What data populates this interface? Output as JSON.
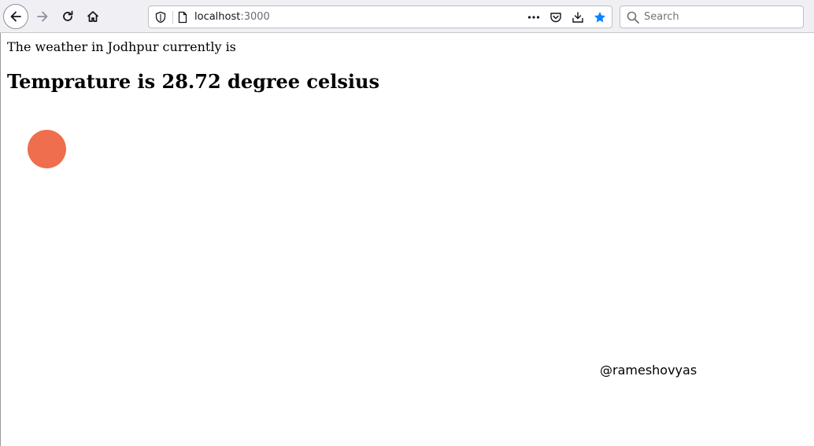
{
  "browser": {
    "url_host": "localhost",
    "url_port": ":3000",
    "search_placeholder": "Search",
    "accent_color": "#0a84ff"
  },
  "page": {
    "intro_text": "The weather in Jodhpur currently is",
    "temperature_heading": "Temprature is 28.72 degree celsius",
    "indicator_color": "#ee6e4d",
    "handle": "@rameshovyas"
  },
  "icons": {
    "back": "arrow-left-icon",
    "forward": "arrow-right-icon",
    "reload": "reload-icon",
    "home": "home-icon",
    "tracking": "shield-icon",
    "page": "page-icon",
    "more": "more-icon",
    "pocket": "pocket-icon",
    "download": "download-icon",
    "bookmark": "star-icon",
    "search": "search-icon"
  }
}
